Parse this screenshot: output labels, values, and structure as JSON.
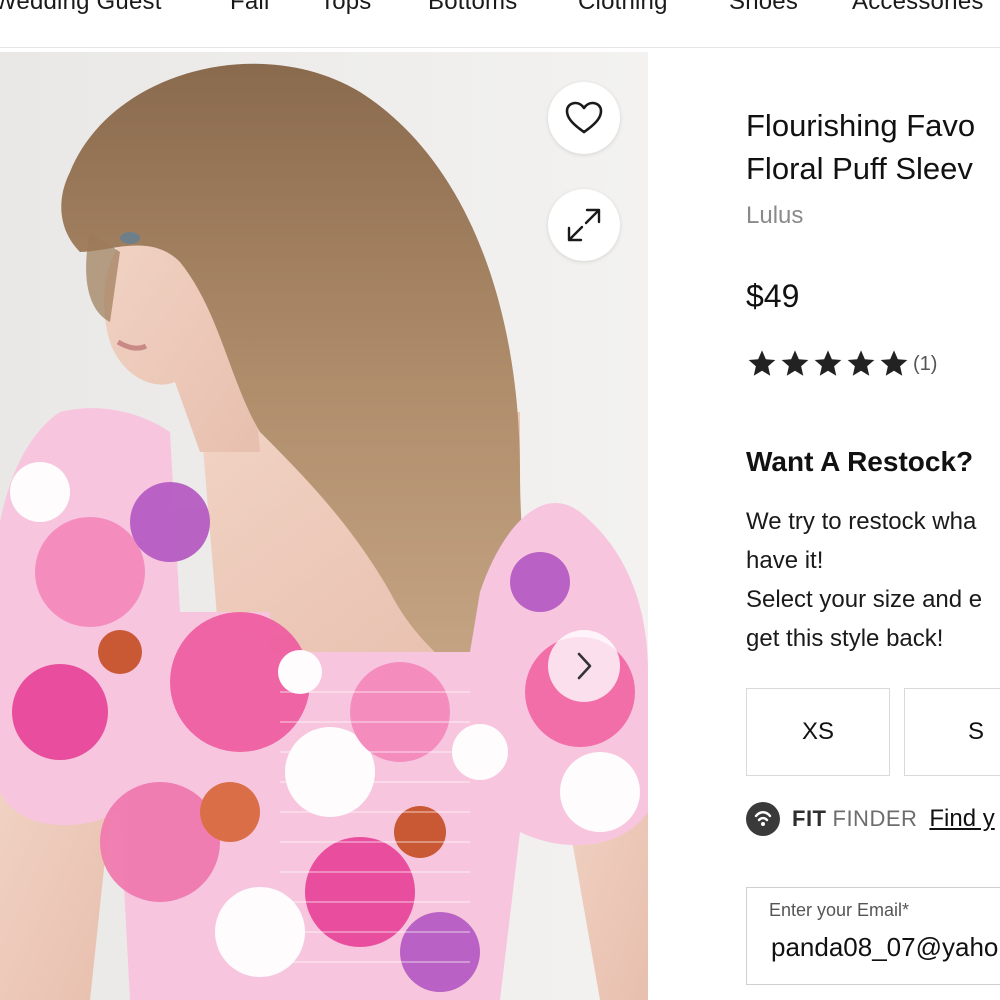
{
  "nav": {
    "items": [
      "Wedding Guest",
      "Fall",
      "Tops",
      "Bottoms",
      "Clothing",
      "Shoes",
      "Accessories"
    ]
  },
  "gallery": {
    "wishlist_icon": "heart-icon",
    "expand_icon": "expand-icon",
    "next_icon": "chevron-right-icon"
  },
  "product": {
    "title_line1": "Flourishing Favo",
    "title_line2": "Floral Puff Sleev",
    "brand": "Lulus",
    "price": "$49",
    "rating": {
      "stars": 5,
      "max": 5,
      "count_label": "(1)"
    }
  },
  "restock": {
    "heading": "Want A Restock?",
    "lines": [
      "We try to restock wha",
      "have it!",
      "Select your size and e",
      "get this style back!"
    ]
  },
  "sizes": [
    "XS",
    "S"
  ],
  "fit_finder": {
    "fit": "FIT",
    "finder": "FINDER",
    "link": "Find y"
  },
  "email": {
    "label": "Enter your Email*",
    "value": "panda08_07@yaho"
  },
  "colors": {
    "text": "#111111",
    "muted": "#8a8a8a",
    "border": "#d9d9d9",
    "photo_bg": "#ecebe9",
    "top_pink": "#f06aa8"
  }
}
